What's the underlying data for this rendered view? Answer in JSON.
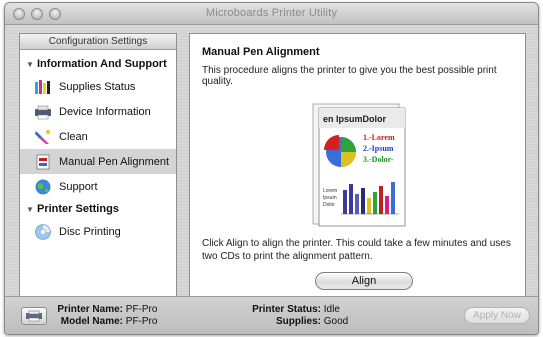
{
  "window": {
    "title": "Microboards Printer Utility"
  },
  "sidebar": {
    "header": "Configuration Settings",
    "groups": [
      {
        "label": "Information And Support",
        "items": [
          {
            "label": "Supplies Status",
            "icon": "supplies-icon"
          },
          {
            "label": "Device Information",
            "icon": "printer-device-icon"
          },
          {
            "label": "Clean",
            "icon": "clean-brush-icon"
          },
          {
            "label": "Manual Pen Alignment",
            "icon": "pen-alignment-icon",
            "selected": true
          },
          {
            "label": "Support",
            "icon": "support-globe-icon"
          }
        ]
      },
      {
        "label": "Printer Settings",
        "items": [
          {
            "label": "Disc Printing",
            "icon": "disc-printing-icon"
          }
        ]
      }
    ]
  },
  "content": {
    "title": "Manual Pen Alignment",
    "description": "This procedure aligns the printer to give you the best possible print quality.",
    "illustration": {
      "heading": "en IpsumDolor",
      "list": [
        "1.-Lorem",
        "2.-Ipsum",
        "3.-Dolor-"
      ],
      "side_text": [
        "Lorem",
        "Ipsum",
        "Dolor"
      ]
    },
    "align_text": "Click Align to align the printer. This could take a few minutes and uses two CDs to print the alignment pattern.",
    "align_button": "Align"
  },
  "status": {
    "printer_name_label": "Printer Name:",
    "printer_name": "PF-Pro",
    "model_name_label": "Model Name:",
    "model_name": "PF-Pro",
    "printer_status_label": "Printer Status:",
    "printer_status": "Idle",
    "supplies_label": "Supplies:",
    "supplies": "Good",
    "apply_button": "Apply Now"
  },
  "colors": {
    "selected_row": "#d4d4d4",
    "list_red": "#c0201f",
    "list_blue": "#1f3fc0",
    "list_green": "#1f8f2a"
  }
}
